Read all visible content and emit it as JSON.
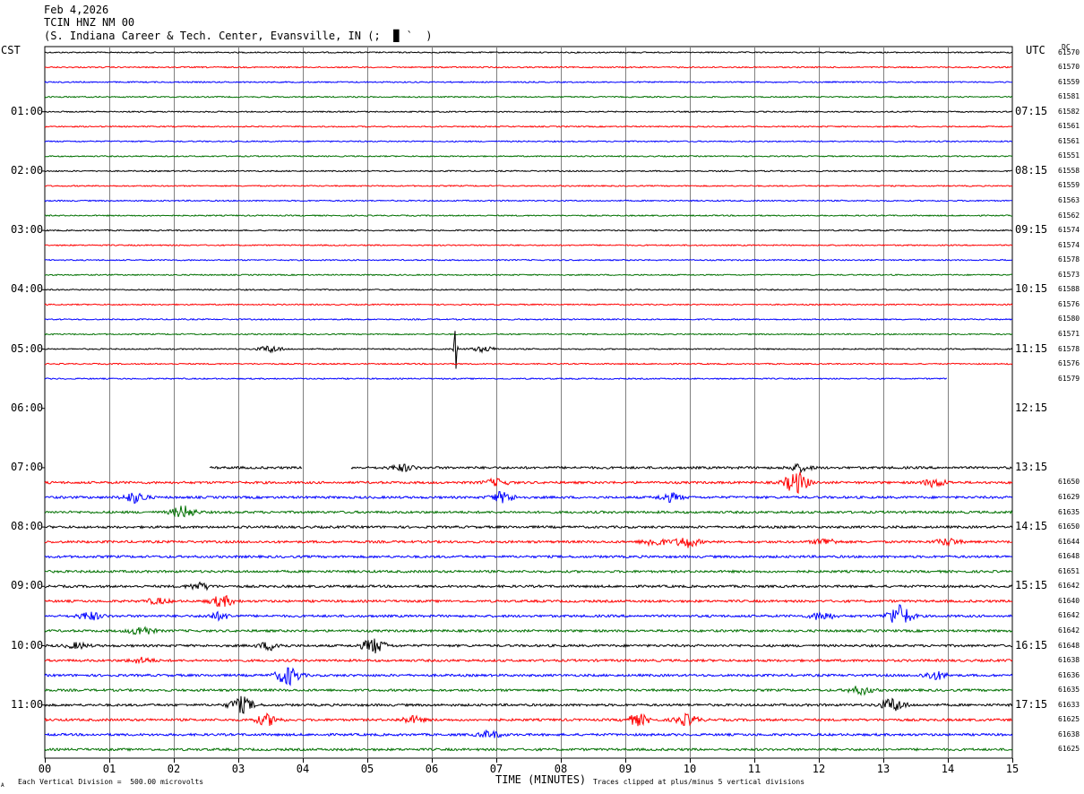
{
  "header": {
    "date": "Feb 4,2026",
    "station": "TCIN HNZ NM 00",
    "location": "(S. Indiana Career & Tech. Center, Evansville, IN (;  ▉ `  )"
  },
  "labels": {
    "left_tz": "CST",
    "right_tz": "UTC",
    "dc_header": "DC",
    "xlabel": "TIME (MINUTES)",
    "scale_note": "Each Vertical Division =  500.00 microvolts",
    "clip_note": "Traces clipped at plus/minus 5 vertical divisions",
    "corner_mark": "A"
  },
  "colors": {
    "trace_cycle": [
      "#000000",
      "#ff0000",
      "#0000ff",
      "#007000"
    ],
    "grid": "#808080",
    "frame": "#000000"
  },
  "chart_data": {
    "type": "line",
    "title": "TCIN HNZ NM 00",
    "xlabel": "TIME (MINUTES)",
    "xlim": [
      0,
      15
    ],
    "x_ticks": [
      "00",
      "01",
      "02",
      "03",
      "04",
      "05",
      "06",
      "07",
      "08",
      "09",
      "10",
      "11",
      "12",
      "13",
      "14",
      "15"
    ],
    "left_hour_labels": [
      "01:00",
      "02:00",
      "03:00",
      "04:00",
      "05:00",
      "06:00",
      "07:00",
      "08:00",
      "09:00",
      "10:00",
      "11:00"
    ],
    "right_hour_labels": [
      "07:15",
      "08:15",
      "09:15",
      "10:15",
      "11:15",
      "12:15",
      "13:15",
      "14:15",
      "15:15",
      "16:15",
      "17:15"
    ],
    "trace_rows": 48,
    "row_offsets": [
      {
        "row": 0,
        "dc": "61570"
      },
      {
        "row": 1,
        "dc": "61570"
      },
      {
        "row": 2,
        "dc": "61559"
      },
      {
        "row": 3,
        "dc": "61581"
      },
      {
        "row": 4,
        "dc": "61582"
      },
      {
        "row": 5,
        "dc": "61561"
      },
      {
        "row": 6,
        "dc": "61561"
      },
      {
        "row": 7,
        "dc": "61551"
      },
      {
        "row": 8,
        "dc": "61558"
      },
      {
        "row": 9,
        "dc": "61559"
      },
      {
        "row": 10,
        "dc": "61563"
      },
      {
        "row": 11,
        "dc": "61562"
      },
      {
        "row": 12,
        "dc": "61574"
      },
      {
        "row": 13,
        "dc": "61574"
      },
      {
        "row": 14,
        "dc": "61578"
      },
      {
        "row": 15,
        "dc": "61573"
      },
      {
        "row": 16,
        "dc": "61588"
      },
      {
        "row": 17,
        "dc": "61576"
      },
      {
        "row": 18,
        "dc": "61580"
      },
      {
        "row": 19,
        "dc": "61571"
      },
      {
        "row": 20,
        "dc": "61578"
      },
      {
        "row": 21,
        "dc": "61576"
      },
      {
        "row": 22,
        "dc": "61579"
      },
      {
        "row": 29,
        "dc": "61650"
      },
      {
        "row": 30,
        "dc": "61629"
      },
      {
        "row": 31,
        "dc": "61635"
      },
      {
        "row": 32,
        "dc": "61650"
      },
      {
        "row": 33,
        "dc": "61644"
      },
      {
        "row": 34,
        "dc": "61648"
      },
      {
        "row": 35,
        "dc": "61651"
      },
      {
        "row": 36,
        "dc": "61642"
      },
      {
        "row": 37,
        "dc": "61640"
      },
      {
        "row": 38,
        "dc": "61642"
      },
      {
        "row": 39,
        "dc": "61642"
      },
      {
        "row": 40,
        "dc": "61648"
      },
      {
        "row": 41,
        "dc": "61638"
      },
      {
        "row": 42,
        "dc": "61636"
      },
      {
        "row": 43,
        "dc": "61635"
      },
      {
        "row": 44,
        "dc": "61633"
      },
      {
        "row": 45,
        "dc": "61625"
      },
      {
        "row": 46,
        "dc": "61638"
      },
      {
        "row": 47,
        "dc": "61625"
      }
    ],
    "data_gaps": [
      {
        "rows": "22",
        "from_min": 14.0,
        "to_min": 15.0
      },
      {
        "rows": "23-27",
        "from_min": 0,
        "to_min": 15.0
      },
      {
        "rows": "28",
        "from_min": 0,
        "to_min": 2.55
      },
      {
        "rows": "28",
        "from_min": 4.0,
        "to_min": 4.75
      }
    ],
    "events": [
      {
        "row": 20,
        "min": 3.5,
        "amp": 0.5
      },
      {
        "row": 20,
        "min": 6.37,
        "amp": 4.5
      },
      {
        "row": 20,
        "min": 6.8,
        "amp": 0.4
      },
      {
        "row": 28,
        "min": 5.55,
        "amp": 0.5
      },
      {
        "row": 28,
        "min": 11.7,
        "amp": 0.5
      },
      {
        "row": 29,
        "min": 11.65,
        "amp": 1.6
      },
      {
        "row": 29,
        "min": 13.8,
        "amp": 0.6
      },
      {
        "row": 29,
        "min": 7.0,
        "amp": 0.5
      },
      {
        "row": 30,
        "min": 1.4,
        "amp": 0.8
      },
      {
        "row": 30,
        "min": 7.1,
        "amp": 0.8
      },
      {
        "row": 30,
        "min": 9.7,
        "amp": 0.6
      },
      {
        "row": 31,
        "min": 2.15,
        "amp": 0.9
      },
      {
        "row": 33,
        "min": 9.45,
        "amp": 0.6
      },
      {
        "row": 33,
        "min": 9.95,
        "amp": 0.8
      },
      {
        "row": 33,
        "min": 12.1,
        "amp": 0.5
      },
      {
        "row": 33,
        "min": 14.0,
        "amp": 0.5
      },
      {
        "row": 36,
        "min": 2.4,
        "amp": 0.5
      },
      {
        "row": 37,
        "min": 2.75,
        "amp": 0.8
      },
      {
        "row": 37,
        "min": 1.75,
        "amp": 0.4
      },
      {
        "row": 38,
        "min": 0.7,
        "amp": 0.6
      },
      {
        "row": 38,
        "min": 2.7,
        "amp": 0.5
      },
      {
        "row": 38,
        "min": 12.05,
        "amp": 0.6
      },
      {
        "row": 38,
        "min": 13.25,
        "amp": 1.7
      },
      {
        "row": 39,
        "min": 1.5,
        "amp": 0.7
      },
      {
        "row": 40,
        "min": 3.5,
        "amp": 0.6
      },
      {
        "row": 40,
        "min": 5.1,
        "amp": 1.1
      },
      {
        "row": 40,
        "min": 0.5,
        "amp": 0.4
      },
      {
        "row": 41,
        "min": 1.5,
        "amp": 0.4
      },
      {
        "row": 42,
        "min": 3.77,
        "amp": 1.4
      },
      {
        "row": 42,
        "min": 13.8,
        "amp": 0.6
      },
      {
        "row": 43,
        "min": 12.65,
        "amp": 0.6
      },
      {
        "row": 44,
        "min": 3.05,
        "amp": 1.2
      },
      {
        "row": 44,
        "min": 13.15,
        "amp": 1.0
      },
      {
        "row": 45,
        "min": 3.45,
        "amp": 0.8
      },
      {
        "row": 45,
        "min": 5.7,
        "amp": 0.5
      },
      {
        "row": 45,
        "min": 9.2,
        "amp": 0.8
      },
      {
        "row": 45,
        "min": 9.95,
        "amp": 0.8
      },
      {
        "row": 46,
        "min": 6.9,
        "amp": 0.5
      }
    ]
  }
}
